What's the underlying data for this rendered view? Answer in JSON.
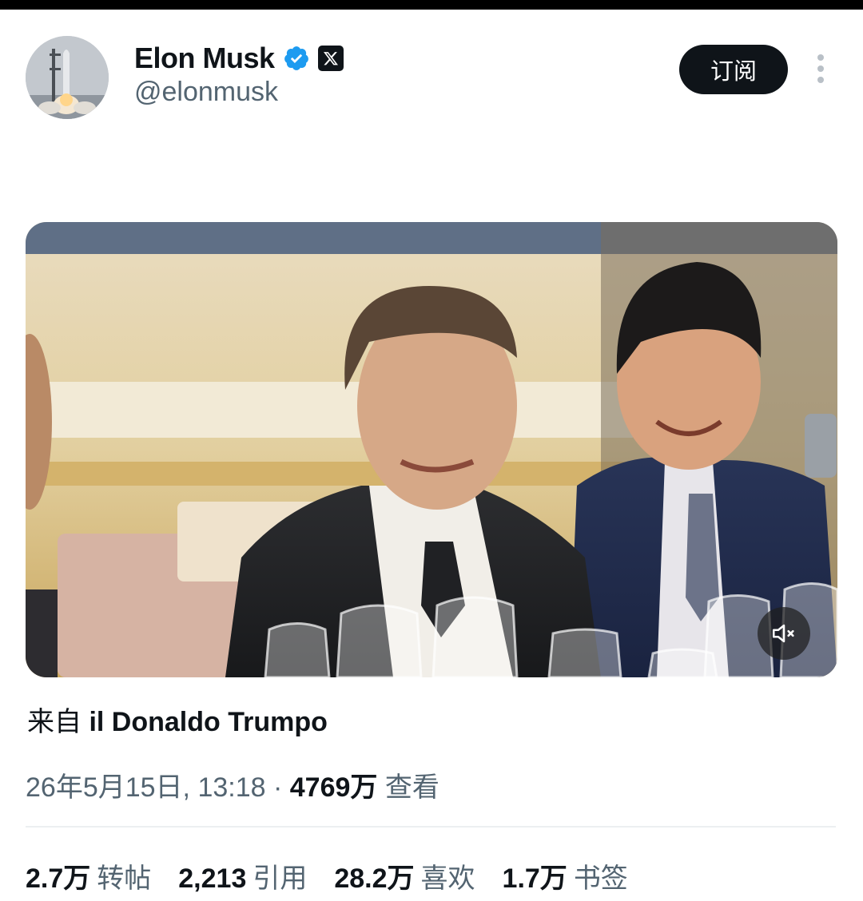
{
  "user": {
    "name": "Elon Musk",
    "handle": "@elonmusk"
  },
  "header": {
    "subscribe_label": "订阅"
  },
  "post": {
    "source_prefix": "来自",
    "source_name": "il Donaldo Trumpo",
    "timestamp": "26年5月15日, 13:18 · ",
    "views_count": "4769万",
    "views_label": "查看"
  },
  "stats": [
    {
      "value": "2.7万",
      "label": "转帖"
    },
    {
      "value": "2,213",
      "label": "引用"
    },
    {
      "value": "28.2万",
      "label": "喜欢"
    },
    {
      "value": "1.7万",
      "label": "书签"
    }
  ],
  "colors": {
    "verified_blue": "#1d9bf0",
    "text_primary": "#0f1419",
    "text_secondary": "#536471"
  }
}
